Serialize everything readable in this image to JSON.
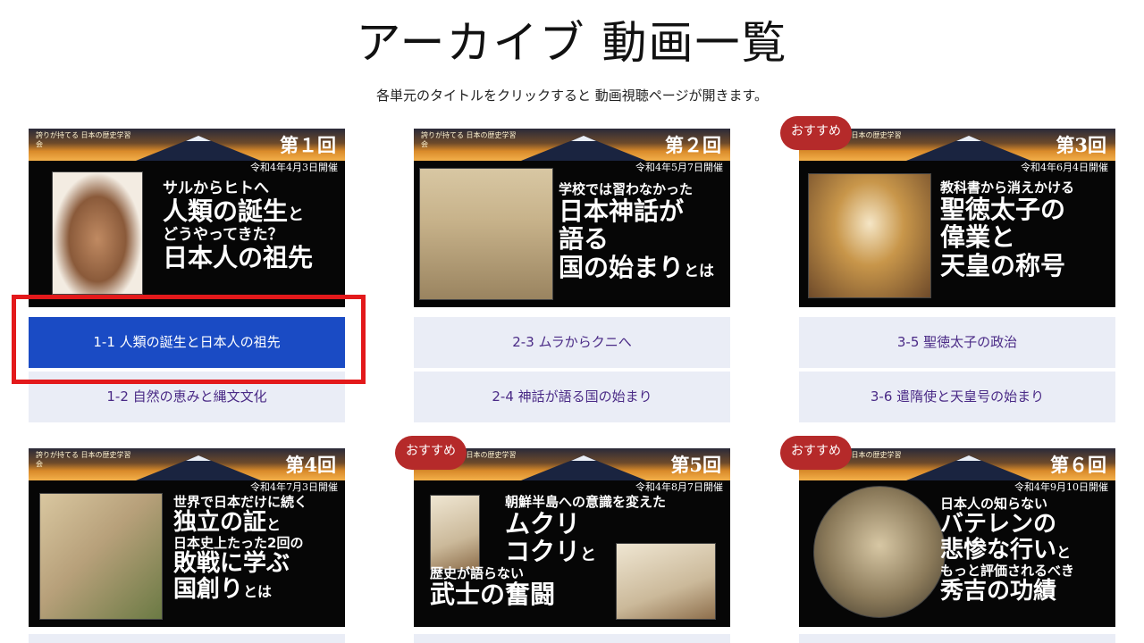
{
  "header": {
    "title": "アーカイブ 動画一覧",
    "subtitle": "各単元のタイトルをクリックすると 動画視聴ページが開きます。"
  },
  "series_label": "誇りが持てる 日本の歴史学習会",
  "badge_label": "おすすめ",
  "cards": [
    {
      "episode": "第１回",
      "date": "令和4年4月3日開催",
      "title_lines": [
        "サルからヒトへ",
        "人類の誕生",
        "と",
        "どうやってきた？",
        "日本人の祖先"
      ],
      "picture": "caveman-portrait-icon",
      "lessons": [
        "1-1 人類の誕生と日本人の祖先",
        "1-2 自然の恵みと縄文文化"
      ]
    },
    {
      "episode": "第２回",
      "date": "令和4年5月7日開催",
      "title_lines": [
        "学校では習わなかった",
        "日本神話が",
        "語る",
        "国の始まり",
        "とは"
      ],
      "picture": "mythology-painting-icon",
      "lessons": [
        "2-3 ムラからクニへ",
        "2-4 神話が語る国の始まり"
      ]
    },
    {
      "episode": "第3回",
      "date": "令和4年6月4日開催",
      "title_lines": [
        "教科書から消えかける",
        "聖徳太子の",
        "偉業と",
        "天皇の称号"
      ],
      "picture": "prince-shotoku-portrait-icon",
      "lessons": [
        "3-5 聖徳太子の政治",
        "3-6 遣隋使と天皇号の始まり"
      ]
    },
    {
      "episode": "第4回",
      "date": "令和4年7月3日開催",
      "title_lines": [
        "世界で日本だけに続く",
        "独立の証",
        "と",
        "日本史上たった2回の",
        "敗戦に学ぶ",
        "国創り",
        "とは"
      ],
      "picture": "emaki-scroll-icon",
      "lessons": []
    },
    {
      "episode": "第5回",
      "date": "令和4年8月7日開催",
      "title_lines": [
        "朝鮮半島への意識を変えた",
        "ムクリ",
        "コクリ",
        "と",
        "歴史が語らない",
        "武士の奮闘"
      ],
      "picture": "samurai-battle-icon",
      "lessons": []
    },
    {
      "episode": "第６回",
      "date": "令和4年9月10日開催",
      "title_lines": [
        "日本人の知らない",
        "バテレンの",
        "悲惨な行い",
        "と",
        "もっと評価されるべき",
        "秀吉の功績"
      ],
      "picture": "hideyoshi-portrait-icon",
      "lessons": []
    }
  ],
  "colors": {
    "lesson_bg": "#eaedf6",
    "lesson_text": "#4a2a86",
    "lesson_active_bg": "#1a4bc4",
    "badge_bg": "#b52a2a",
    "highlight": "#e3191b"
  }
}
